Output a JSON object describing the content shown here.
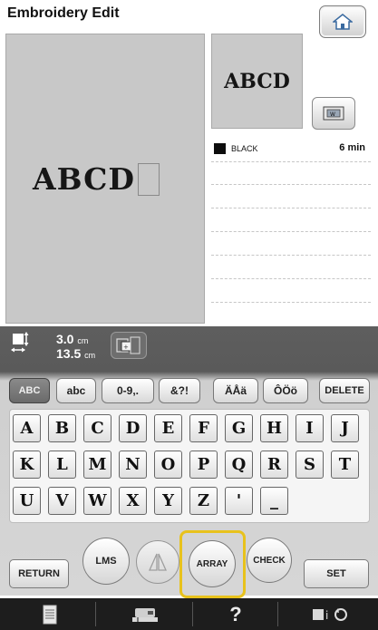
{
  "header": {
    "title": "Embroidery Edit",
    "home_icon": "home-icon"
  },
  "preview": {
    "text": "ABCD"
  },
  "thumbnail": {
    "text": "ABCD",
    "view_button_icon": "magnify-view-icon"
  },
  "thread": {
    "color_name": "BLACK",
    "swatch": "#0d0d0d",
    "time": "6 min"
  },
  "size": {
    "width": "3.0",
    "width_unit": "cm",
    "height": "13.5",
    "height_unit": "cm"
  },
  "tabs": [
    {
      "label": "ABC"
    },
    {
      "label": "abc"
    },
    {
      "label": "0-9,."
    },
    {
      "label": "&?!"
    },
    {
      "label": "ÄÅä"
    },
    {
      "label": "ÔÖö"
    }
  ],
  "delete_label": "DELETE",
  "keys": {
    "row1": [
      "A",
      "B",
      "C",
      "D",
      "E",
      "F",
      "G",
      "H",
      "I",
      "J"
    ],
    "row2": [
      "K",
      "L",
      "M",
      "N",
      "O",
      "P",
      "Q",
      "R",
      "S",
      "T"
    ],
    "row3": [
      "U",
      "V",
      "W",
      "X",
      "Y",
      "Z",
      "'",
      "_"
    ]
  },
  "buttons": {
    "return": "RETURN",
    "lms": "LMS",
    "array": "ARRAY",
    "check": "CHECK",
    "set": "SET"
  },
  "bottom_icons": [
    "page-icon",
    "sewing-machine-icon",
    "help-icon",
    "settings-icon"
  ],
  "bottom_help": "?"
}
